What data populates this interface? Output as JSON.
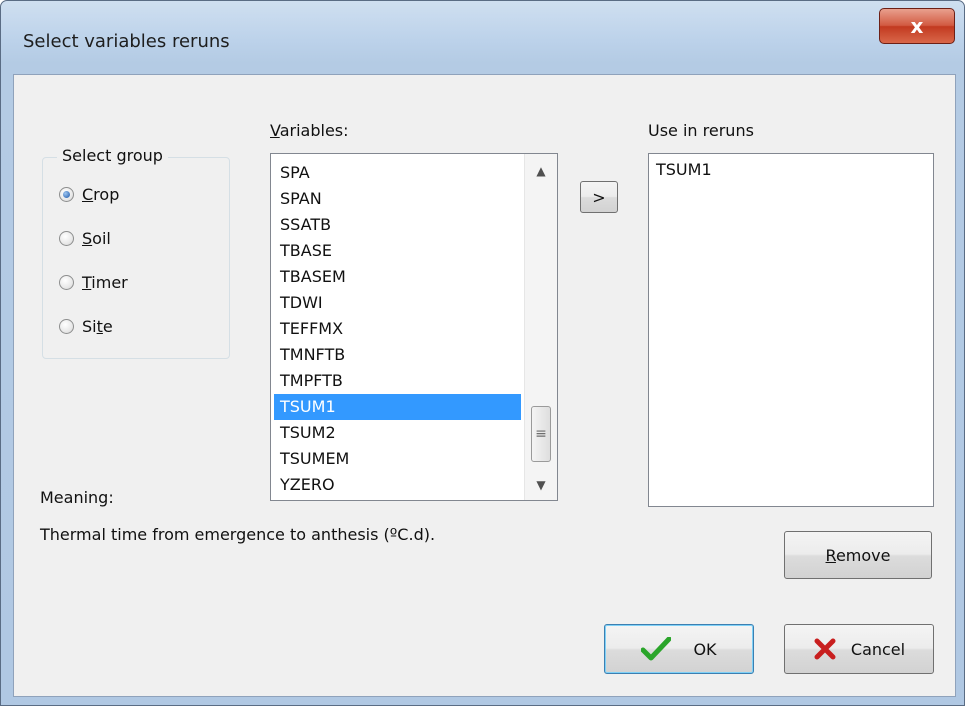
{
  "window": {
    "title": "Select variables reruns",
    "close_glyph": "x"
  },
  "group": {
    "legend": "Select group",
    "options": [
      {
        "label": "Crop",
        "selected": true,
        "accel": "C"
      },
      {
        "label": "Soil",
        "selected": false,
        "accel": "S"
      },
      {
        "label": "Timer",
        "selected": false,
        "accel": "T"
      },
      {
        "label": "Site",
        "selected": false,
        "accel": "t"
      }
    ]
  },
  "variables": {
    "label": "Variables:",
    "items": [
      "SPA",
      "SPAN",
      "SSATB",
      "TBASE",
      "TBASEM",
      "TDWI",
      "TEFFMX",
      "TMNFTB",
      "TMPFTB",
      "TSUM1",
      "TSUM2",
      "TSUMEM",
      "YZERO"
    ],
    "selected": "TSUM1",
    "scroll_up_glyph": "▲",
    "scroll_down_glyph": "▼",
    "thumb_glyph": "≡"
  },
  "add_button": {
    "label": ">"
  },
  "reruns": {
    "label": "Use in reruns",
    "items": [
      "TSUM1"
    ]
  },
  "meaning": {
    "label": "Meaning:",
    "text": "Thermal time from emergence to anthesis (ºC.d)."
  },
  "buttons": {
    "remove_label": "Remove",
    "ok_label": "OK",
    "cancel_label": "Cancel"
  },
  "icons": {
    "close": "close-icon",
    "ok": "checkmark-icon",
    "cancel": "cross-icon"
  },
  "colors": {
    "selection": "#3399ff",
    "ok_check": "#2aa52a",
    "cancel_cross": "#c81e1e",
    "close_button": "#c9452b"
  }
}
